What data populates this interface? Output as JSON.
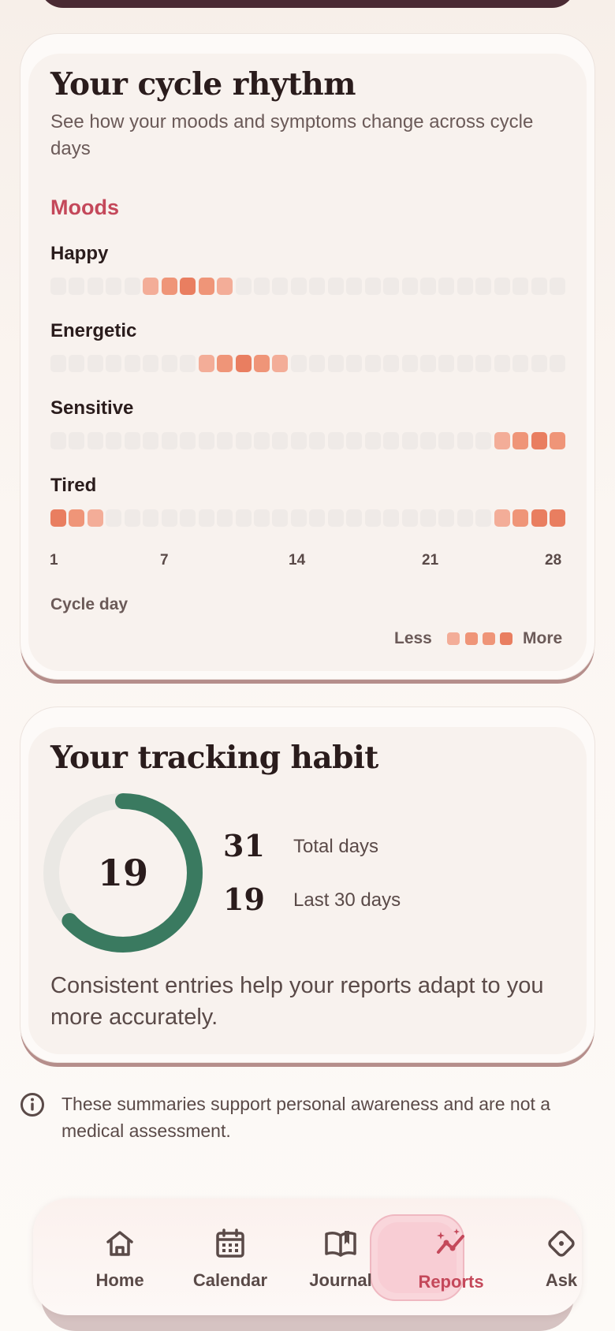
{
  "rhythm": {
    "title": "Your cycle rhythm",
    "subtitle": "See how your moods and symptoms change across cycle days",
    "section": "Moods",
    "rows": [
      {
        "label": "Happy",
        "levels": [
          0,
          0,
          0,
          0,
          0,
          1,
          2,
          3,
          2,
          1,
          0,
          0,
          0,
          0,
          0,
          0,
          0,
          0,
          0,
          0,
          0,
          0,
          0,
          0,
          0,
          0,
          0,
          0
        ]
      },
      {
        "label": "Energetic",
        "levels": [
          0,
          0,
          0,
          0,
          0,
          0,
          0,
          0,
          1,
          2,
          3,
          2,
          1,
          0,
          0,
          0,
          0,
          0,
          0,
          0,
          0,
          0,
          0,
          0,
          0,
          0,
          0,
          0
        ]
      },
      {
        "label": "Sensitive",
        "levels": [
          0,
          0,
          0,
          0,
          0,
          0,
          0,
          0,
          0,
          0,
          0,
          0,
          0,
          0,
          0,
          0,
          0,
          0,
          0,
          0,
          0,
          0,
          0,
          0,
          1,
          2,
          3,
          2
        ]
      },
      {
        "label": "Tired",
        "levels": [
          3,
          2,
          1,
          0,
          0,
          0,
          0,
          0,
          0,
          0,
          0,
          0,
          0,
          0,
          0,
          0,
          0,
          0,
          0,
          0,
          0,
          0,
          0,
          0,
          1,
          2,
          3,
          3
        ]
      }
    ],
    "axis_ticks": [
      "1",
      "7",
      "14",
      "21",
      "28"
    ],
    "axis_title": "Cycle day",
    "legend_less": "Less",
    "legend_more": "More",
    "colors": {
      "empty": "#efeae7",
      "level1": "#f3ad98",
      "level2": "#ef9578",
      "level3": "#e97e60",
      "accent": "#c4485a",
      "ring": "#3a7a60",
      "ring_track": "#eae8e4"
    }
  },
  "habit": {
    "title": "Your tracking habit",
    "ring_value": "19",
    "ring_fraction": 0.633,
    "stats": [
      {
        "value": "31",
        "label": "Total days"
      },
      {
        "value": "19",
        "label": "Last 30 days"
      }
    ],
    "note": "Consistent entries help your reports adapt to you more accurately."
  },
  "disclaimer": {
    "icon": "info-icon",
    "text": "These summaries support personal awareness and are not a medical assessment."
  },
  "nav": {
    "items": [
      {
        "label": "Home",
        "icon": "home-icon"
      },
      {
        "label": "Calendar",
        "icon": "calendar-icon"
      },
      {
        "label": "Journal",
        "icon": "journal-icon"
      },
      {
        "label": "Reports",
        "icon": "reports-icon",
        "active": true
      },
      {
        "label": "Ask",
        "icon": "ask-icon"
      }
    ]
  }
}
